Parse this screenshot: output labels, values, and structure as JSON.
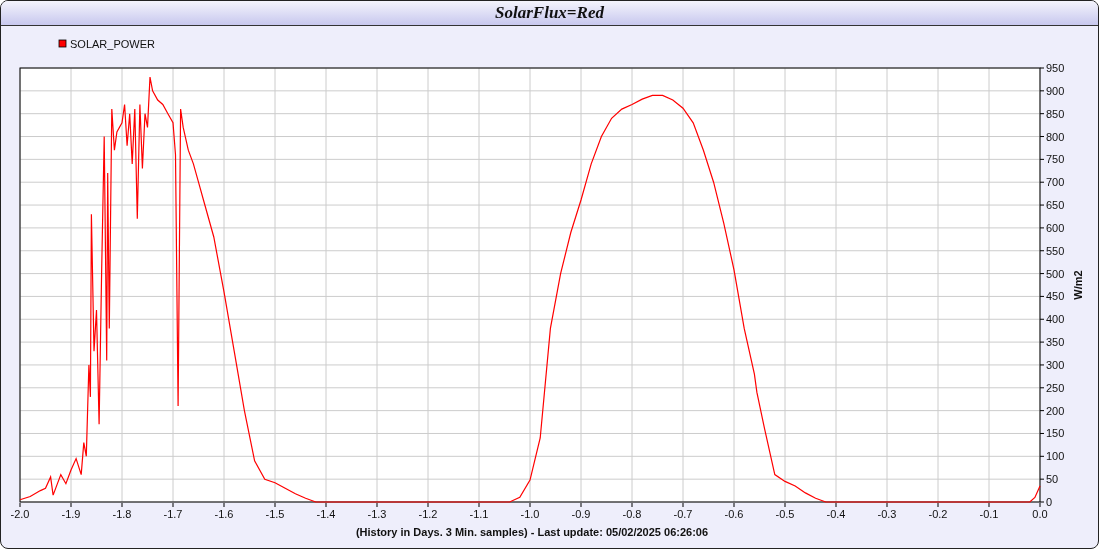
{
  "window": {
    "title": "SolarFlux=Red"
  },
  "chart": {
    "chart_data": {
      "type": "line",
      "xlabel": "(History in Days. 3 Min. samples) - Last update: 05/02/2025 06:26:06",
      "ylabel": "W/m2",
      "grid": true,
      "xlim": [
        -2.0,
        0.0
      ],
      "ylim": [
        0,
        950
      ],
      "xticks": [
        {
          "value": -2.0,
          "label": "-2.0"
        },
        {
          "value": -1.9,
          "label": "-1.9"
        },
        {
          "value": -1.8,
          "label": "-1.8"
        },
        {
          "value": -1.7,
          "label": "-1.7"
        },
        {
          "value": -1.6,
          "label": "-1.6"
        },
        {
          "value": -1.5,
          "label": "-1.5"
        },
        {
          "value": -1.4,
          "label": "-1.4"
        },
        {
          "value": -1.3,
          "label": "-1.3"
        },
        {
          "value": -1.2,
          "label": "-1.2"
        },
        {
          "value": -1.1,
          "label": "-1.1"
        },
        {
          "value": -1.0,
          "label": "-1.0"
        },
        {
          "value": -0.9,
          "label": "-0.9"
        },
        {
          "value": -0.8,
          "label": "-0.8"
        },
        {
          "value": -0.7,
          "label": "-0.7"
        },
        {
          "value": -0.6,
          "label": "-0.6"
        },
        {
          "value": -0.5,
          "label": "-0.5"
        },
        {
          "value": -0.4,
          "label": "-0.4"
        },
        {
          "value": -0.3,
          "label": "-0.3"
        },
        {
          "value": -0.2,
          "label": "-0.2"
        },
        {
          "value": -0.1,
          "label": "-0.1"
        },
        {
          "value": 0.0,
          "label": "0.0"
        }
      ],
      "yticks": [
        0,
        50,
        100,
        150,
        200,
        250,
        300,
        350,
        400,
        450,
        500,
        550,
        600,
        650,
        700,
        750,
        800,
        850,
        900,
        950
      ],
      "x": [
        -2.0,
        -1.98,
        -1.96,
        -1.95,
        -1.94,
        -1.935,
        -1.92,
        -1.91,
        -1.9,
        -1.89,
        -1.88,
        -1.875,
        -1.87,
        -1.865,
        -1.862,
        -1.86,
        -1.855,
        -1.85,
        -1.845,
        -1.84,
        -1.835,
        -1.83,
        -1.828,
        -1.825,
        -1.82,
        -1.815,
        -1.81,
        -1.8,
        -1.795,
        -1.79,
        -1.785,
        -1.78,
        -1.775,
        -1.77,
        -1.765,
        -1.76,
        -1.755,
        -1.75,
        -1.745,
        -1.74,
        -1.73,
        -1.72,
        -1.71,
        -1.7,
        -1.695,
        -1.69,
        -1.685,
        -1.68,
        -1.67,
        -1.66,
        -1.65,
        -1.64,
        -1.62,
        -1.6,
        -1.58,
        -1.56,
        -1.54,
        -1.52,
        -1.5,
        -1.48,
        -1.46,
        -1.44,
        -1.42,
        -1.04,
        -1.02,
        -1.0,
        -0.98,
        -0.96,
        -0.94,
        -0.92,
        -0.9,
        -0.88,
        -0.86,
        -0.84,
        -0.82,
        -0.8,
        -0.78,
        -0.76,
        -0.74,
        -0.72,
        -0.7,
        -0.68,
        -0.66,
        -0.64,
        -0.62,
        -0.6,
        -0.58,
        -0.56,
        -0.555,
        -0.54,
        -0.52,
        -0.5,
        -0.48,
        -0.46,
        -0.44,
        -0.42,
        -0.02,
        -0.01,
        0.0
      ],
      "series": [
        {
          "name": "SOLAR_POWER",
          "color": "#ff0000",
          "values": [
            5,
            12,
            25,
            30,
            55,
            15,
            60,
            40,
            70,
            95,
            60,
            130,
            100,
            300,
            230,
            630,
            330,
            420,
            170,
            500,
            800,
            310,
            720,
            380,
            860,
            770,
            810,
            830,
            870,
            780,
            850,
            740,
            860,
            620,
            870,
            730,
            850,
            820,
            930,
            900,
            880,
            870,
            850,
            830,
            760,
            210,
            860,
            820,
            770,
            740,
            700,
            660,
            580,
            460,
            330,
            200,
            90,
            50,
            42,
            30,
            18,
            8,
            0,
            0,
            10,
            48,
            140,
            380,
            500,
            590,
            661,
            740,
            800,
            840,
            860,
            870,
            882,
            890,
            890,
            880,
            862,
            830,
            770,
            700,
            610,
            508,
            380,
            280,
            240,
            160,
            60,
            45,
            35,
            20,
            8,
            0,
            0,
            10,
            35
          ]
        }
      ]
    }
  }
}
